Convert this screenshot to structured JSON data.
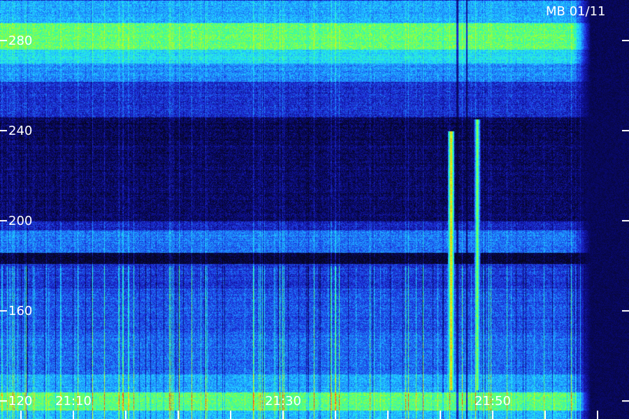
{
  "chart_data": {
    "type": "heatmap",
    "title": "MB 01/11",
    "xlabel": "",
    "ylabel": "",
    "y_axis": {
      "ticks": [
        "280",
        "240",
        "200",
        "160",
        "120"
      ],
      "ylim": [
        112,
        298
      ]
    },
    "x_axis": {
      "ticks": [
        "21:10",
        "21:30",
        "21:50"
      ],
      "tick_values_min": [
        70,
        90,
        110
      ],
      "xlim": [
        63,
        123
      ],
      "minor_step_min": 5
    },
    "colormap": [
      "#050518",
      "#0a0a7a",
      "#1e2ad8",
      "#1d8cff",
      "#22e0ff",
      "#38ff9a",
      "#b4ff1e",
      "#ffe01e",
      "#ff3a10"
    ],
    "intensity_profile": [
      {
        "from": 112,
        "to": 116,
        "level": 0.45
      },
      {
        "from": 116,
        "to": 124,
        "level": 0.65
      },
      {
        "from": 124,
        "to": 132,
        "level": 0.42
      },
      {
        "from": 132,
        "to": 150,
        "level": 0.33
      },
      {
        "from": 150,
        "to": 170,
        "level": 0.3
      },
      {
        "from": 170,
        "to": 181,
        "level": 0.26
      },
      {
        "from": 181,
        "to": 186,
        "level": 0.04
      },
      {
        "from": 186,
        "to": 196,
        "level": 0.35
      },
      {
        "from": 196,
        "to": 200,
        "level": 0.22
      },
      {
        "from": 200,
        "to": 236,
        "level": 0.1
      },
      {
        "from": 236,
        "to": 246,
        "level": 0.08
      },
      {
        "from": 246,
        "to": 262,
        "level": 0.24
      },
      {
        "from": 262,
        "to": 270,
        "level": 0.38
      },
      {
        "from": 270,
        "to": 276,
        "level": 0.5
      },
      {
        "from": 276,
        "to": 288,
        "level": 0.66
      },
      {
        "from": 288,
        "to": 298,
        "level": 0.42
      }
    ],
    "bursts": [
      {
        "time_min": 106.0,
        "freq_from": 125,
        "freq_to": 240,
        "level": 0.9
      },
      {
        "time_min": 108.5,
        "freq_from": 125,
        "freq_to": 245,
        "level": 0.75
      }
    ],
    "grid": false,
    "legend": "none"
  }
}
